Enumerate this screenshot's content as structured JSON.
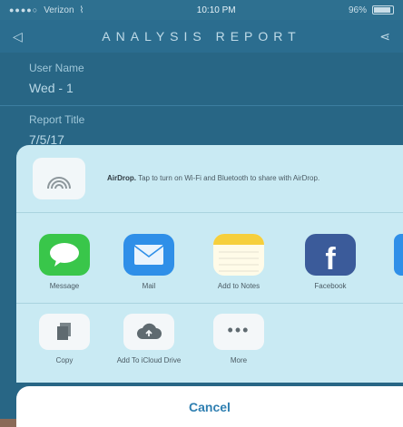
{
  "status": {
    "carrier": "Verizon",
    "time": "10:10 PM",
    "battery": "96%"
  },
  "navbar": {
    "title": "ANALYSIS REPORT"
  },
  "form": {
    "user_name_label": "User Name",
    "user_name_value": "Wed - 1",
    "report_title_label": "Report Title",
    "report_title_value": "7/5/17"
  },
  "share": {
    "airdrop": {
      "title": "AirDrop.",
      "text": "Tap to turn on Wi-Fi and Bluetooth to share with AirDrop."
    },
    "apps": [
      {
        "label": "Message",
        "icon": "messages-icon"
      },
      {
        "label": "Mail",
        "icon": "mail-icon"
      },
      {
        "label": "Add to Notes",
        "icon": "notes-icon"
      },
      {
        "label": "Facebook",
        "icon": "facebook-icon"
      }
    ],
    "actions": [
      {
        "label": "Copy",
        "icon": "copy-icon"
      },
      {
        "label": "Add To iCloud Drive",
        "icon": "icloud-drive-icon"
      },
      {
        "label": "More",
        "icon": "more-icon"
      }
    ],
    "cancel_label": "Cancel"
  },
  "colors": {
    "background": "#2a6a8a",
    "sheet": "#c9eaf3",
    "cancel_text": "#2f7fb1"
  }
}
